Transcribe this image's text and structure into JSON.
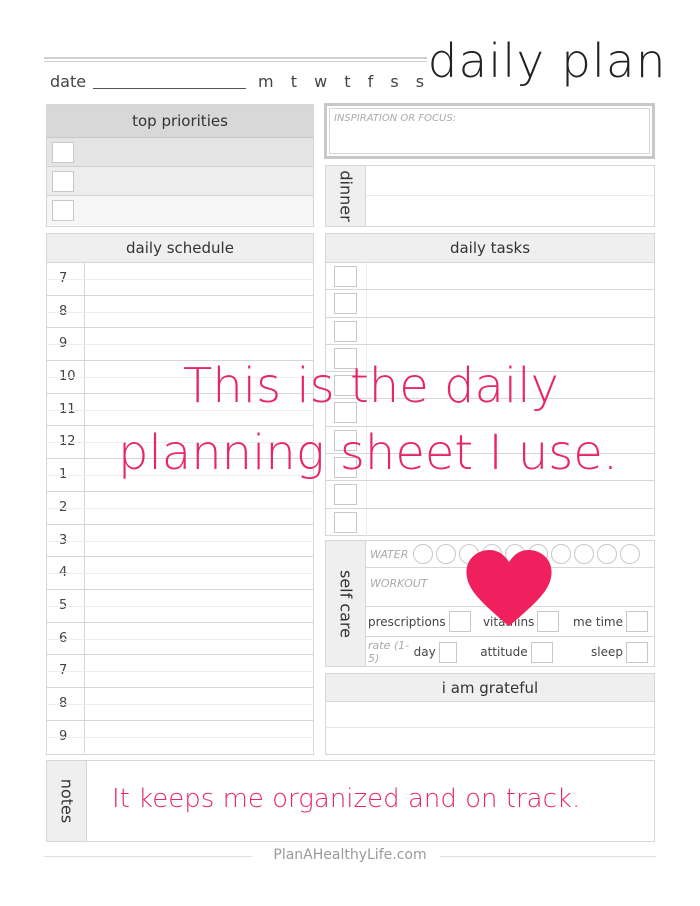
{
  "header": {
    "title": "daily plan",
    "date_label": "date",
    "weekdays": [
      "m",
      "t",
      "w",
      "t",
      "f",
      "s",
      "s"
    ]
  },
  "top_priorities": {
    "title": "top priorities",
    "count": 3
  },
  "inspiration": {
    "label": "INSPIRATION OR FOCUS:"
  },
  "dinner": {
    "label": "dinner"
  },
  "daily_schedule": {
    "title": "daily schedule",
    "hours": [
      "7",
      "8",
      "9",
      "10",
      "11",
      "12",
      "1",
      "2",
      "3",
      "4",
      "5",
      "6",
      "7",
      "8",
      "9"
    ]
  },
  "daily_tasks": {
    "title": "daily tasks",
    "count": 10
  },
  "self_care": {
    "label": "self care",
    "water_label": "WATER",
    "water_glasses": 10,
    "workout_label": "WORKOUT",
    "checks": [
      "prescriptions",
      "vitamins",
      "me time"
    ],
    "rate_label": "rate (1-5)",
    "ratings": [
      "day",
      "attitude",
      "sleep"
    ]
  },
  "grateful": {
    "title": "i am grateful"
  },
  "notes": {
    "label": "notes"
  },
  "footer": {
    "text": "PlanAHealthyLife.com"
  },
  "overlay": {
    "line1": "This is the daily",
    "line2": "planning sheet I use.",
    "line3": "It keeps me organized and on track.",
    "color": "#e8256b",
    "heart_color": "#f0205f"
  }
}
